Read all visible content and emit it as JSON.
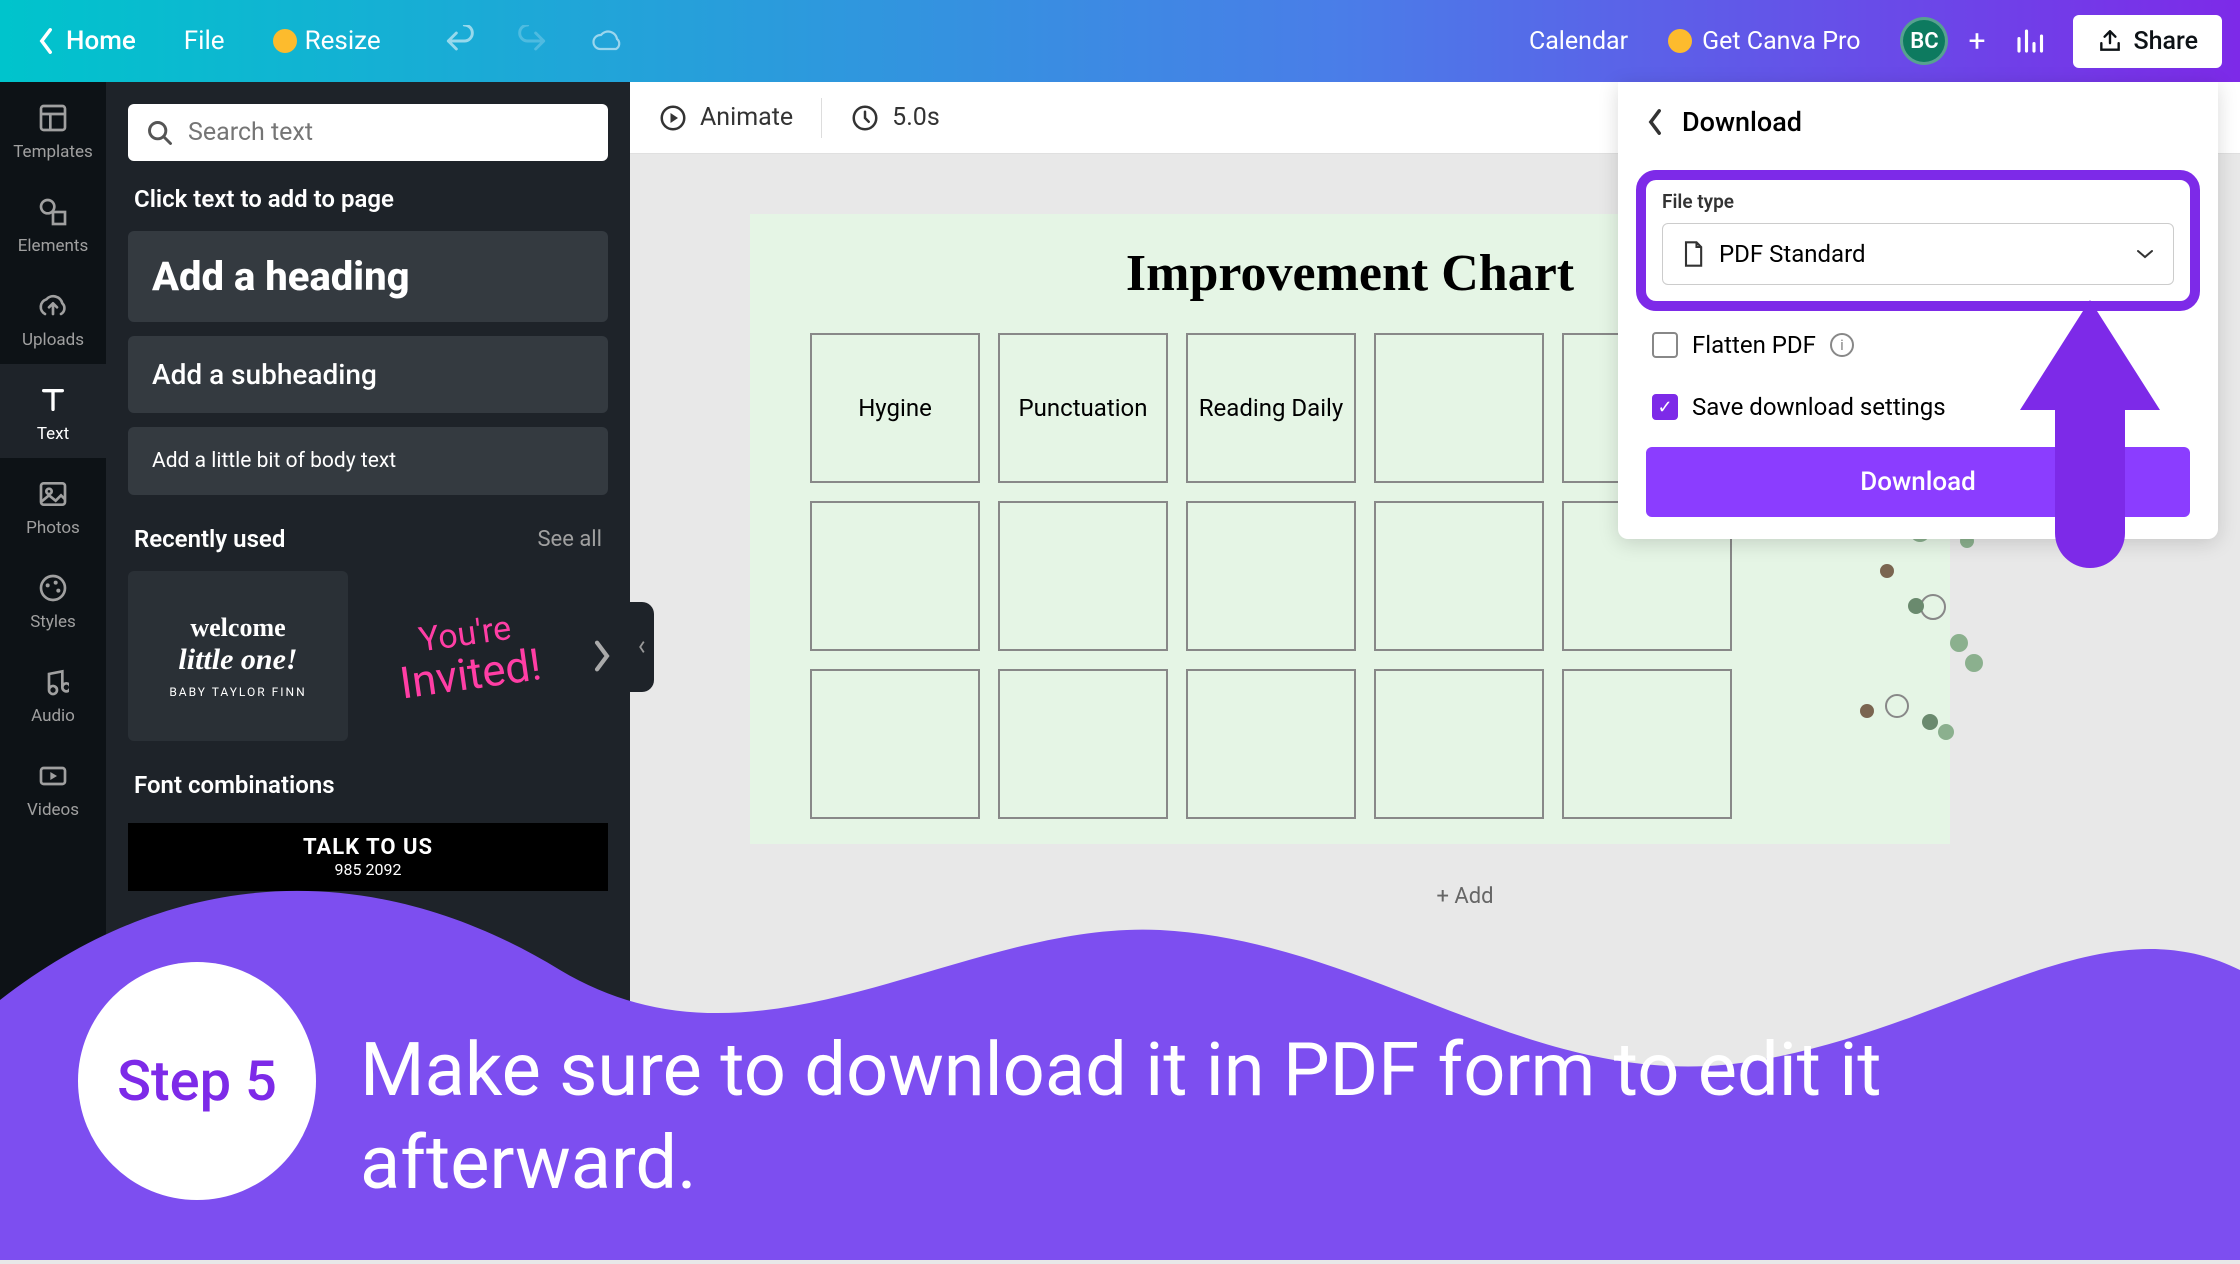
{
  "topbar": {
    "home": "Home",
    "file": "File",
    "resize": "Resize",
    "calendar": "Calendar",
    "get_pro": "Get Canva Pro",
    "avatar_initials": "BC",
    "share": "Share"
  },
  "nav": {
    "templates": "Templates",
    "elements": "Elements",
    "uploads": "Uploads",
    "text": "Text",
    "photos": "Photos",
    "styles": "Styles",
    "audio": "Audio",
    "videos": "Videos"
  },
  "panel": {
    "search_placeholder": "Search text",
    "click_label": "Click text to add to page",
    "heading": "Add a heading",
    "subheading": "Add a subheading",
    "body": "Add a little bit of body text",
    "recently_used": "Recently used",
    "see_all": "See all",
    "recent1_l1": "welcome",
    "recent1_l2": "little one!",
    "recent1_l3": "BABY TAYLOR FINN",
    "recent2_l1": "You're",
    "recent2_l2": "Invited!",
    "font_combinations": "Font combinations",
    "talk_title": "TALK TO US",
    "talk_num": "985 2092"
  },
  "toolbar": {
    "animate": "Animate",
    "duration": "5.0s"
  },
  "canvas": {
    "title": "Improvement Chart",
    "cells": [
      "Hygine",
      "Punctuation",
      "Reading Daily"
    ],
    "add_page": "+ Add"
  },
  "download": {
    "title": "Download",
    "file_type_label": "File type",
    "file_type_value": "PDF Standard",
    "flatten": "Flatten PDF",
    "save_settings": "Save download settings",
    "button": "Download"
  },
  "overlay": {
    "step": "Step 5",
    "text": "Make sure to download it in PDF form to edit it afterward."
  }
}
